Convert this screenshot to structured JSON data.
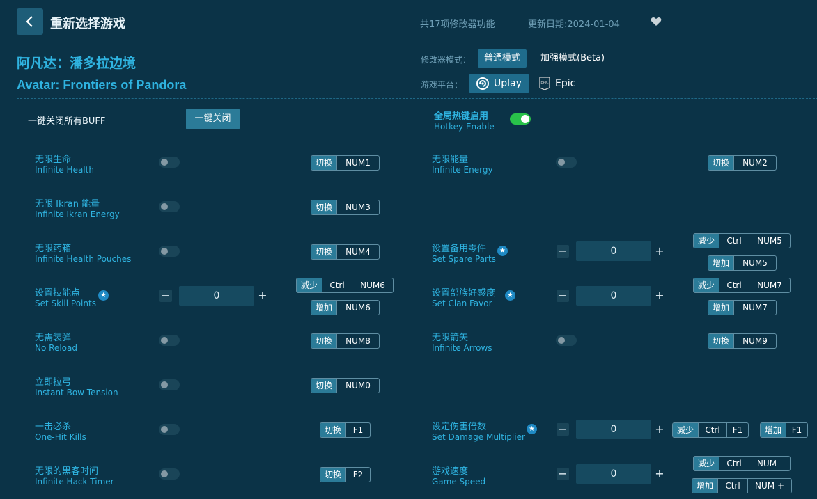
{
  "header": {
    "back_label": "<",
    "title": "重新选择游戏",
    "feature_count": "共17项修改器功能",
    "update_date": "更新日期:2024-01-04"
  },
  "game": {
    "name_cn": "阿凡达：潘多拉边境",
    "name_en": "Avatar: Frontiers of Pandora"
  },
  "mode": {
    "label": "修改器模式：",
    "normal": "普通模式",
    "enhanced": "加强模式(Beta)"
  },
  "platform": {
    "label": "游戏平台：",
    "uplay": "Uplay",
    "epic": "Epic",
    "epic_logo_text": "EPIC"
  },
  "controls": {
    "close_all_label": "一键关闭所有BUFF",
    "close_all_button": "一键关闭",
    "hotkey_cn": "全局热键启用",
    "hotkey_en": "Hotkey Enable"
  },
  "tags": {
    "toggle": "切换",
    "decrease": "减少",
    "increase": "增加"
  },
  "features": {
    "f1": {
      "cn": "无限生命",
      "en": "Infinite Health",
      "key": "NUM1"
    },
    "f2": {
      "cn": "无限能量",
      "en": "Infinite Energy",
      "key": "NUM2"
    },
    "f3": {
      "cn": "无限 Ikran 能量",
      "en": "Infinite Ikran Energy",
      "key": "NUM3"
    },
    "f4": {
      "cn": "无限药箱",
      "en": "Infinite Health Pouches",
      "key": "NUM4"
    },
    "f5": {
      "cn": "设置备用零件",
      "en": "Set Spare Parts",
      "value": "0",
      "dec_mod": "Ctrl",
      "dec_key": "NUM5",
      "inc_key": "NUM5"
    },
    "f6": {
      "cn": "设置技能点",
      "en": "Set Skill Points",
      "value": "0",
      "dec_mod": "Ctrl",
      "dec_key": "NUM6",
      "inc_key": "NUM6"
    },
    "f7": {
      "cn": "设置部族好感度",
      "en": "Set Clan Favor",
      "value": "0",
      "dec_mod": "Ctrl",
      "dec_key": "NUM7",
      "inc_key": "NUM7"
    },
    "f8": {
      "cn": "无需装弹",
      "en": "No Reload",
      "key": "NUM8"
    },
    "f9": {
      "cn": "无限箭矢",
      "en": "Infinite Arrows",
      "key": "NUM9"
    },
    "f10": {
      "cn": "立即拉弓",
      "en": "Instant Bow Tension",
      "key": "NUM0"
    },
    "f11": {
      "cn": "一击必杀",
      "en": "One-Hit Kills",
      "key": "F1"
    },
    "f12": {
      "cn": "设定伤害倍数",
      "en": "Set Damage Multiplier",
      "value": "0",
      "dec_mod": "Ctrl",
      "dec_key": "F1",
      "inc_key": "F1"
    },
    "f13": {
      "cn": "无限的黑客时间",
      "en": "Infinite Hack Timer",
      "key": "F2"
    },
    "f14": {
      "cn": "游戏速度",
      "en": "Game Speed",
      "value": "0",
      "dec_mod": "Ctrl",
      "dec_key": "NUM -",
      "inc_mod": "Ctrl",
      "inc_key": "NUM +"
    }
  },
  "stepper": {
    "minus": "−",
    "plus": "+"
  },
  "star_glyph": "★",
  "colors": {
    "background": "#0b3347",
    "accent": "#2fb3e0",
    "button": "#2b7b98",
    "toggle_on": "#29c24a"
  }
}
